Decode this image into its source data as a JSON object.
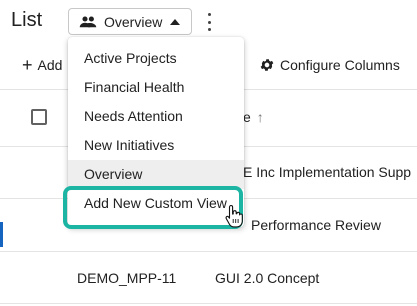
{
  "header": {
    "title": "List",
    "view_selector": {
      "label": "Overview"
    }
  },
  "toolbar": {
    "add_label": "Add",
    "configure_columns_label": "Configure Columns"
  },
  "table": {
    "name_header": "e",
    "rows": [
      {
        "id": "",
        "name": "E Inc Implementation Supp"
      },
      {
        "id": "",
        "name": "Performance Review"
      },
      {
        "id": "DEMO_MPP-11",
        "name": "GUI 2.0 Concept"
      }
    ]
  },
  "view_menu": {
    "items": [
      {
        "label": "Active Projects"
      },
      {
        "label": "Financial Health"
      },
      {
        "label": "Needs Attention"
      },
      {
        "label": "New Initiatives"
      },
      {
        "label": "Overview",
        "selected": true
      },
      {
        "label": "Add New Custom View"
      }
    ]
  },
  "colors": {
    "highlight": "#1cb5a4",
    "accent": "#1565c0"
  }
}
